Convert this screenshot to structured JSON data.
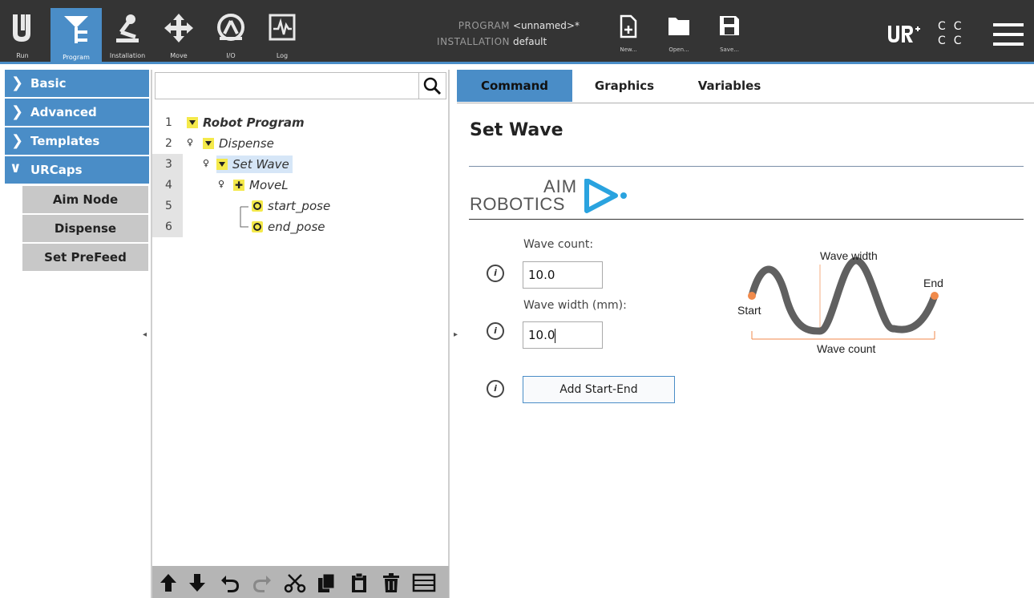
{
  "topbar": {
    "nav": [
      {
        "id": "run",
        "label": "Run"
      },
      {
        "id": "program",
        "label": "Program"
      },
      {
        "id": "installation",
        "label": "Installation"
      },
      {
        "id": "move",
        "label": "Move"
      },
      {
        "id": "io",
        "label": "I/O"
      },
      {
        "id": "log",
        "label": "Log"
      }
    ],
    "program_key": "PROGRAM",
    "program_value": "<unnamed>*",
    "installation_key": "INSTALLATION",
    "installation_value": "default",
    "file_buttons": [
      {
        "id": "new",
        "label": "New..."
      },
      {
        "id": "open",
        "label": "Open..."
      },
      {
        "id": "save",
        "label": "Save..."
      }
    ],
    "speed_indicator": [
      "C",
      "C",
      "C",
      "C"
    ],
    "accent_color": "#4a8dc7"
  },
  "sidebar": {
    "categories": [
      {
        "label": "Basic",
        "expanded": false
      },
      {
        "label": "Advanced",
        "expanded": false
      },
      {
        "label": "Templates",
        "expanded": false
      },
      {
        "label": "URCaps",
        "expanded": true
      }
    ],
    "urcaps_items": [
      "Aim Node",
      "Dispense",
      "Set PreFeed"
    ]
  },
  "tree": {
    "search_placeholder": "",
    "lines": [
      {
        "num": "1",
        "label": "Robot Program",
        "icon": "triangle"
      },
      {
        "num": "2",
        "label": "Dispense",
        "icon": "triangle"
      },
      {
        "num": "3",
        "label": "Set Wave",
        "icon": "triangle",
        "selected": true
      },
      {
        "num": "4",
        "label": "MoveL",
        "icon": "move"
      },
      {
        "num": "5",
        "label": "start_pose",
        "icon": "waypoint"
      },
      {
        "num": "6",
        "label": "end_pose",
        "icon": "waypoint"
      }
    ],
    "footer_icons": [
      "arrow-up-icon",
      "arrow-down-icon",
      "undo-icon",
      "redo-icon",
      "cut-icon",
      "copy-icon",
      "paste-icon",
      "delete-icon",
      "suppress-icon"
    ]
  },
  "panel": {
    "tabs": [
      "Command",
      "Graphics",
      "Variables"
    ],
    "active_tab": "Command",
    "title": "Set Wave",
    "logo_top": "AIM",
    "logo_bottom": "ROBOTICS",
    "wave_count_label": "Wave count:",
    "wave_count_value": "10.0",
    "wave_width_label": "Wave width (mm):",
    "wave_width_value": "10.0",
    "add_button_label": "Add Start-End",
    "diagram": {
      "start_label": "Start",
      "end_label": "End",
      "wave_width_label": "Wave width",
      "wave_count_label": "Wave count",
      "line_color": "#606060",
      "marker_color": "#f08a4b"
    }
  }
}
